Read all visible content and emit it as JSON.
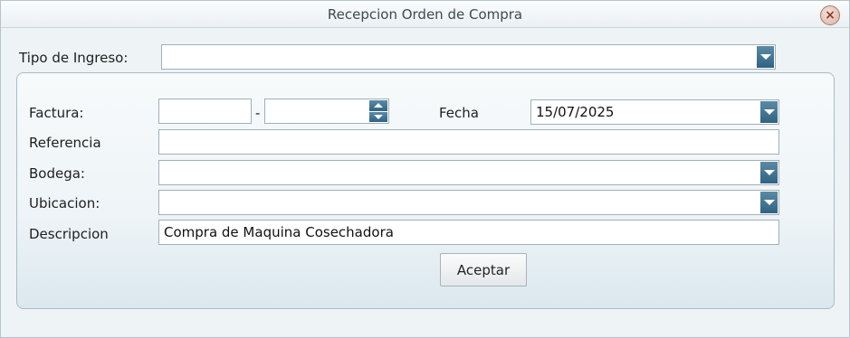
{
  "window": {
    "title": "Recepcion Orden de Compra"
  },
  "form": {
    "tipo_ingreso_label": "Tipo de Ingreso:",
    "tipo_ingreso_value": "",
    "factura_label": "Factura:",
    "factura_part1": "",
    "factura_separator": "-",
    "factura_part2": "",
    "fecha_label": "Fecha",
    "fecha_value": "15/07/2025",
    "referencia_label": "Referencia",
    "referencia_value": "",
    "bodega_label": "Bodega:",
    "bodega_value": "",
    "ubicacion_label": "Ubicacion:",
    "ubicacion_value": "",
    "descripcion_label": "Descripcion",
    "descripcion_value": "Compra de Maquina Cosechadora",
    "accept_label": "Aceptar"
  },
  "icons": {
    "close": "close-icon",
    "dropdown": "chevron-down-icon",
    "spinner": "spinner-icon"
  },
  "colors": {
    "accent": "#2f6383",
    "border": "#9fb0ba"
  }
}
